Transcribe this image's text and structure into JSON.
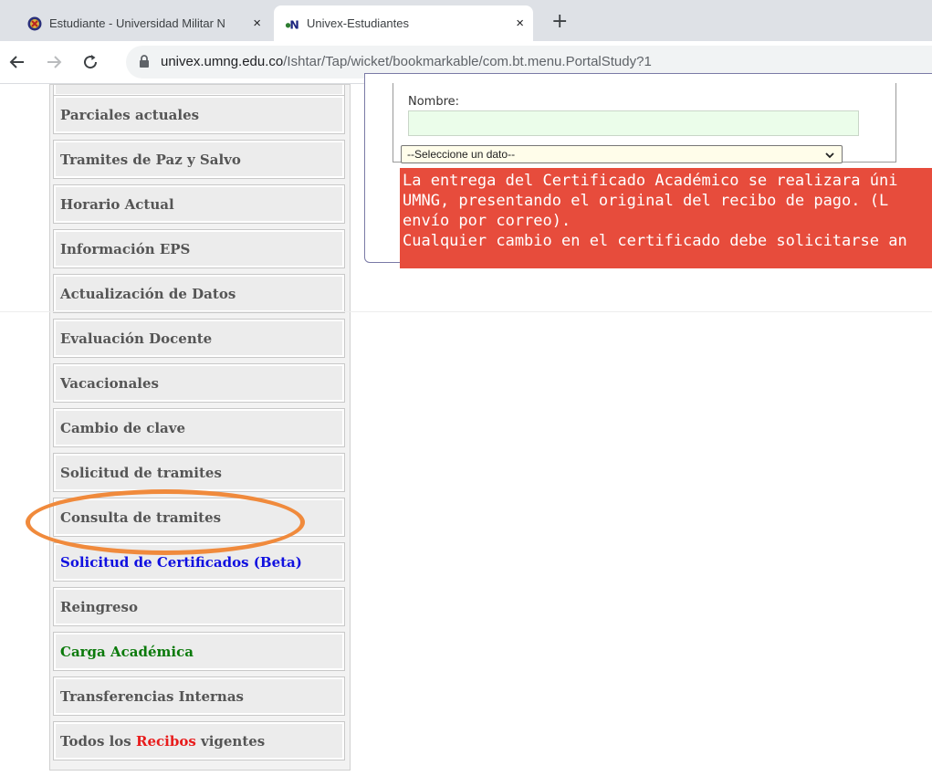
{
  "browser": {
    "tabs": [
      {
        "title": "Estudiante - Universidad Militar N",
        "close": "×"
      },
      {
        "title": "Univex-Estudiantes",
        "close": "×"
      }
    ],
    "new_tab": "+",
    "url_host": "univex.umng.edu.co",
    "url_path": "/Ishtar/Tap/wicket/bookmarkable/com.bt.menu.PortalStudy?1"
  },
  "sidebar": {
    "items": [
      {
        "label": "Parciales actuales"
      },
      {
        "label": "Tramites de Paz y Salvo"
      },
      {
        "label": "Horario Actual"
      },
      {
        "label": "Información EPS"
      },
      {
        "label": "Actualización de Datos"
      },
      {
        "label": "Evaluación Docente"
      },
      {
        "label": "Vacacionales"
      },
      {
        "label": "Cambio de clave"
      },
      {
        "label": "Solicitud de tramites"
      },
      {
        "label": "Consulta de tramites"
      },
      {
        "label": "Solicitud de Certificados (Beta)"
      },
      {
        "label": "Reingreso"
      },
      {
        "label": "Carga Académica"
      },
      {
        "label": "Transferencias Internas"
      },
      {
        "last_prefix": "Todos los ",
        "last_red": "Recibos",
        "last_suffix": " vigentes"
      }
    ]
  },
  "form": {
    "nombre_label": "Nombre:",
    "nombre_value": "",
    "select_value": "--Seleccione un dato--"
  },
  "alert": {
    "lines": [
      "La entrega del Certificado Académico se realizara úni",
      "UMNG, presentando el original del recibo de pago. (L",
      "envío por correo).",
      "Cualquier cambio en el certificado debe solicitarse an"
    ]
  },
  "colors": {
    "alert_bg": "#e74c3c",
    "highlight_ring": "#f08a3c",
    "certificados_link": "#1010e0",
    "carga_link": "#0b7a0b",
    "recibos_word": "#e81c1c"
  }
}
